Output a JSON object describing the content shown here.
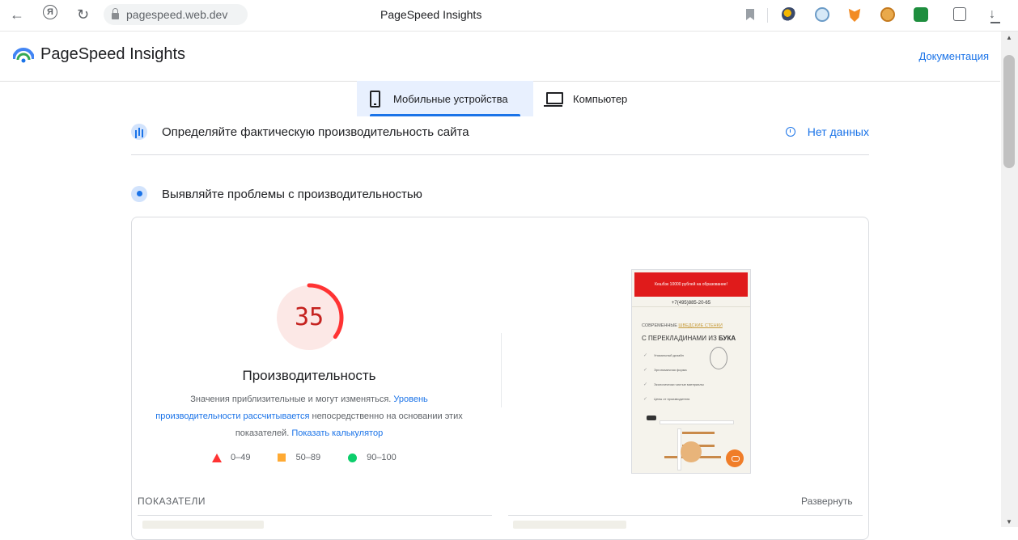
{
  "browser": {
    "address": "pagespeed.web.dev",
    "tab_title": "PageSpeed Insights",
    "back_glyph": "←",
    "home_glyph": "Я",
    "reload_glyph": "↻",
    "download_glyph": "↓"
  },
  "header": {
    "title": "PageSpeed Insights",
    "docs_label": "Документация"
  },
  "device_tabs": [
    {
      "label": "Мобильные устройства",
      "active": true
    },
    {
      "label": "Компьютер",
      "active": false
    }
  ],
  "crux": {
    "title": "Определяйте фактическую производительность сайта",
    "status": "Нет данных"
  },
  "lab": {
    "title": "Выявляйте проблемы с производительностью"
  },
  "performance": {
    "score": "35",
    "score_fraction": 0.35,
    "label": "Производительность",
    "desc_part1": "Значения приблизительные и могут изменяться. ",
    "desc_link1": "Уровень производительности рассчитывается",
    "desc_part2": " непосредственно на основании этих показателей. ",
    "desc_link2": "Показать калькулятор",
    "colors": {
      "poor": "#ff3333",
      "average": "#ffaa33",
      "good": "#0cce6b",
      "score_text": "#c5221f",
      "gauge_bg": "#fce8e6"
    }
  },
  "legend": [
    {
      "icon": "triangle",
      "label": "0–49"
    },
    {
      "icon": "square",
      "label": "50–89"
    },
    {
      "icon": "circle",
      "label": "90–100"
    }
  ],
  "preview": {
    "banner": "Кешбэк 10000 рублей на образование!",
    "phone": "+7(495)885-20-65",
    "line1_a": "СОВРЕМЕННЫЕ ",
    "line1_b": "ШВЕДСКИЕ СТЕНКИ",
    "line2_a": "С ПЕРЕКЛАДИНАМИ ИЗ ",
    "line2_b": "БУКА",
    "items": [
      "Уникальный дизайн",
      "Эргономичная форма",
      "Экологически чистые материалы",
      "Цены от производителя"
    ]
  },
  "metrics": {
    "label": "ПОКАЗАТЕЛИ",
    "expand_label": "Развернуть"
  },
  "scrollbar": {
    "up": "▲",
    "down": "▼"
  }
}
